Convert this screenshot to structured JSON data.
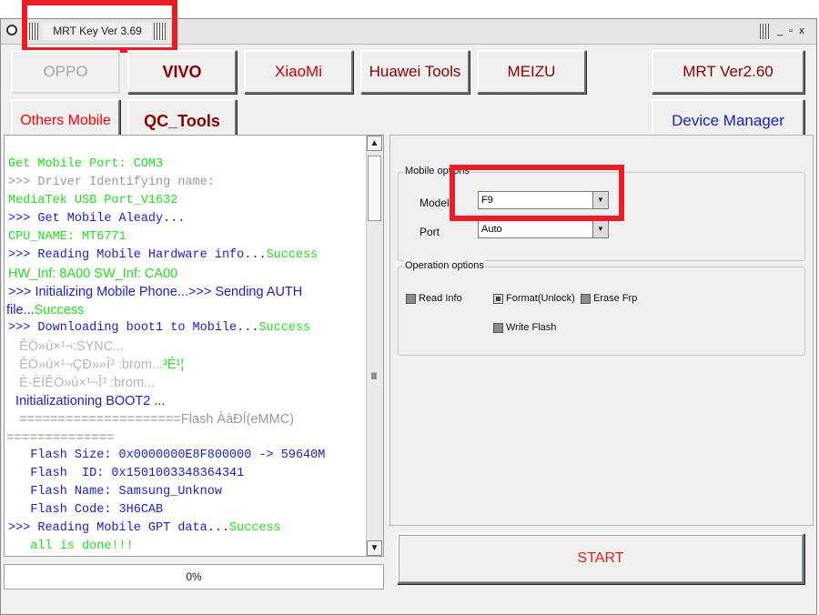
{
  "window": {
    "title": "MRT Key Ver 3.69",
    "controls": {
      "minimize": "_",
      "restore": "▫",
      "close": "x"
    }
  },
  "toolbar": {
    "oppo": "OPPO",
    "vivo": "VIVO",
    "xiaomi": "XiaoMi",
    "huawei": "Huawei Tools",
    "meizu": "MEIZU",
    "mrt": "MRT Ver2.60",
    "others": "Others Mobile",
    "qc_tools": "QC_Tools",
    "device_manager": "Device Manager"
  },
  "log": {
    "lines": [
      {
        "prefix": "",
        "text": "   Get Mobile Port:  COM3",
        "suffix": ""
      },
      {
        "prefix": ">>> ",
        "text": "Driver Identifying name:",
        "suffix": ""
      },
      {
        "prefix": "",
        "text": "   MediaTek USB Port_V1632",
        "suffix": ""
      },
      {
        "prefix": ">>> ",
        "text": "Get Mobile Aleady...",
        "suffix": ""
      },
      {
        "prefix": "",
        "text": "   CPU_NAME: MT6771",
        "suffix": ""
      },
      {
        "prefix": ">>> ",
        "text": "Reading Mobile Hardware info...",
        "suffix": "Success"
      },
      {
        "prefix": "",
        "text": "   HW_Inf: ",
        "value1": "8A00",
        "mid": "   SW_Inf: ",
        "value2": "CA00"
      },
      {
        "prefix": ">>> ",
        "text": "Initializing Mobile Phone...>>> Sending AUTH",
        "suffix": ""
      },
      {
        "prefix": "",
        "text": "file...",
        "suffix": "Success"
      },
      {
        "prefix": ">>> ",
        "text": "Downloading boot1 to Mobile...",
        "suffix": "Success"
      },
      {
        "prefix": "",
        "text": "   ÊÖ»ú×¹¬:SYNC...",
        "suffix": ""
      },
      {
        "prefix": "",
        "text": "   ÊÖ»ú×¹¬ÇÐ»»Î³ :brom...",
        "suffix": "³É¹¦"
      },
      {
        "prefix": "",
        "text": "   È·ÈÏÊÖ»ú×¹¬Î³ :brom...",
        "suffix": ""
      },
      {
        "prefix": "",
        "text": "  Initializationing BOOT2 ...",
        "suffix": ""
      },
      {
        "prefix": "",
        "text": "   =====================",
        "tail": "Flash ÀàÐÍ(eMMC)"
      },
      {
        "prefix": "",
        "text": "==============",
        "suffix": ""
      },
      {
        "prefix": "",
        "text": "   Flash Size: 0x0000000E8F800000 -> 59640M",
        "suffix": ""
      },
      {
        "prefix": "",
        "text": "   Flash  ID: 0x1501003348364341",
        "suffix": ""
      },
      {
        "prefix": "",
        "text": "   Flash Name: Samsung_Unknow",
        "suffix": ""
      },
      {
        "prefix": "",
        "text": "   Flash Code: 3H6CAB",
        "suffix": ""
      },
      {
        "prefix": ">>> ",
        "text": "Reading Mobile GPT data...",
        "suffix": "Success"
      },
      {
        "prefix": "",
        "text": "   all is done!!!",
        "suffix": ""
      }
    ]
  },
  "progress": {
    "label": "0%",
    "value": 0
  },
  "mobile_options": {
    "legend": "Mobile options",
    "model_label": "Model",
    "model_value": "F9",
    "port_label": "Port",
    "port_value": "Auto"
  },
  "operation_options": {
    "legend": "Operation options",
    "read_info": "Read Info",
    "format_unlock": "Format(Unlock)",
    "erase_frp": "Erase Frp",
    "write_flash": "Write Flash"
  },
  "start_button": "START",
  "colors": {
    "green": "#22dd22",
    "gray": "#999999",
    "blue": "#1c1ccc",
    "red": "#ff0000",
    "dark_red": "#8b0000",
    "highlight": "#ec1c24"
  }
}
